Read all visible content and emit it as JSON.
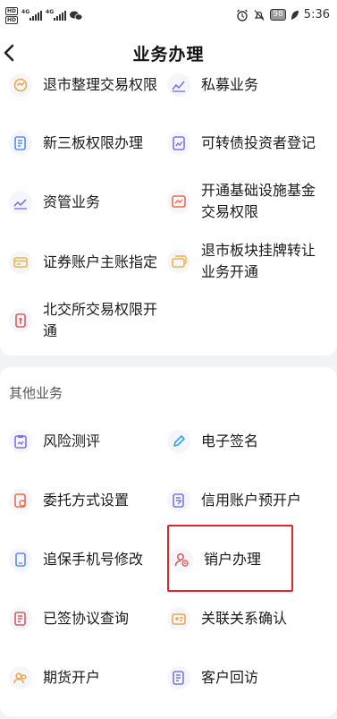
{
  "status_bar": {
    "hd1": "HD",
    "hd2": "HD",
    "net1": "4G",
    "net2": "4G",
    "battery": "98",
    "time": "5:36"
  },
  "header": {
    "title": "业务办理",
    "back_icon": "chevron-left-icon"
  },
  "business_list": [
    {
      "label": "退市整理交易权限",
      "icon": "exchange-icon",
      "color": "#f0a54a"
    },
    {
      "label": "私募业务",
      "icon": "trend-chart-icon",
      "color": "#7c74e8"
    },
    {
      "label": "新三板权限办理",
      "icon": "document-edit-icon",
      "color": "#5b8def"
    },
    {
      "label": "可转债投资者登记",
      "icon": "chart-doc-icon",
      "color": "#7c74e8"
    },
    {
      "label": "资管业务",
      "icon": "trend-chart-icon",
      "color": "#7c74e8"
    },
    {
      "label": "开通基础设施基金交易权限",
      "label_line1": "开通基础设施基金",
      "label_line2": "交易权限",
      "icon": "image-chart-icon",
      "color": "#ef6b4a"
    },
    {
      "label": "证券账户主账指定",
      "icon": "card-icon",
      "color": "#f0b43c"
    },
    {
      "label": "退市板块挂牌转让业务开通",
      "label_line1": "退市板块挂牌转让",
      "label_line2": "业务开通",
      "icon": "stack-card-icon",
      "color": "#f0b43c"
    },
    {
      "label": "北交所交易权限开通",
      "label_line1": "北交所交易权限开",
      "label_line2": "通",
      "icon": "key-lock-icon",
      "color": "#e05a5a"
    }
  ],
  "other_section": {
    "title": "其他业务",
    "items": [
      {
        "label": "风险测评",
        "icon": "clipboard-chart-icon",
        "color": "#7c74e8"
      },
      {
        "label": "电子签名",
        "icon": "pen-icon",
        "color": "#3a9ef5"
      },
      {
        "label": "委托方式设置",
        "icon": "doc-gear-icon",
        "color": "#ef6b4a"
      },
      {
        "label": "信用账户预开户",
        "icon": "document-edit-icon",
        "color": "#7c74e8"
      },
      {
        "label": "追保手机号修改",
        "icon": "phone-icon",
        "color": "#5b8def"
      },
      {
        "label": "销户办理",
        "icon": "user-remove-icon",
        "color": "#e05a5a"
      },
      {
        "label": "已签协议查询",
        "icon": "doc-list-icon",
        "color": "#e05a5a"
      },
      {
        "label": "关联关系确认",
        "icon": "id-card-icon",
        "color": "#f0a54a"
      },
      {
        "label": "期货开户",
        "icon": "people-icon",
        "color": "#f0a54a"
      },
      {
        "label": "客户回访",
        "icon": "doc-list-icon",
        "color": "#7c74e8"
      }
    ]
  }
}
